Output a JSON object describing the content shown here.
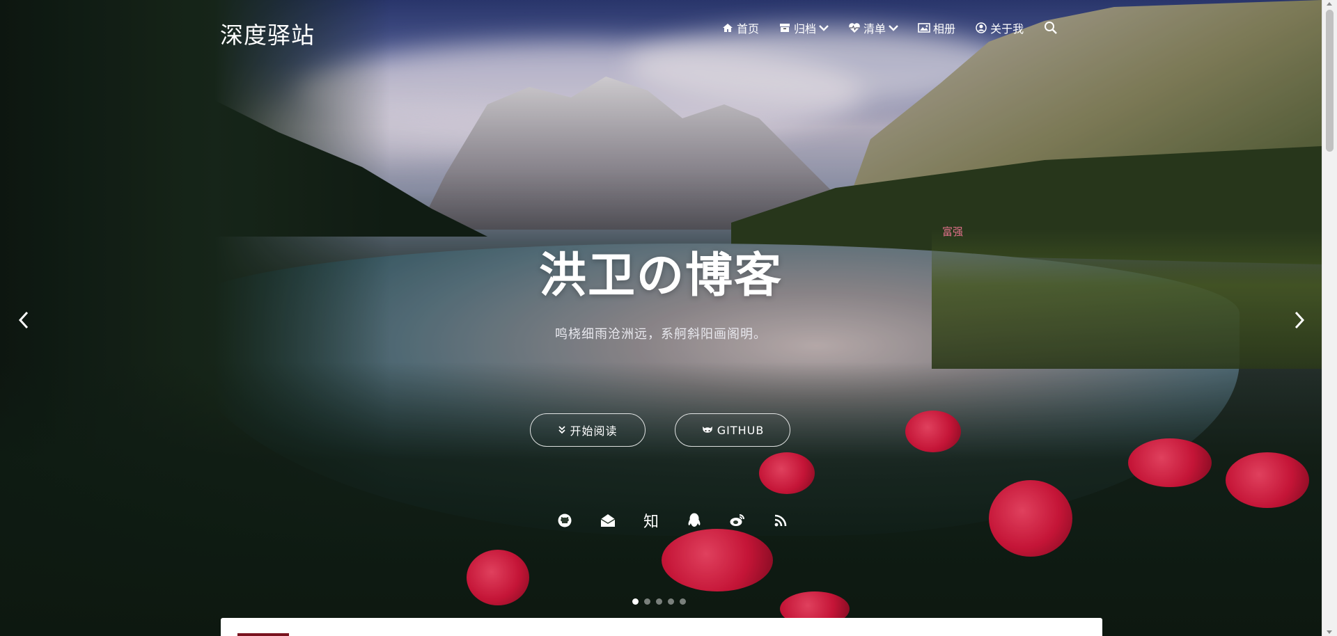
{
  "brand": "深度驿站",
  "nav": {
    "home": "首页",
    "archive": "归档",
    "list": "清单",
    "album": "相册",
    "about": "关于我"
  },
  "icons": {
    "home": "home-icon",
    "archive": "archive-icon",
    "list": "heartbeat-icon",
    "album": "image-icon",
    "about": "user-circle-icon",
    "search": "search-icon",
    "start": "double-chevron-down-icon",
    "github": "github-cat-icon",
    "prev": "chevron-left-icon",
    "next": "chevron-right-icon"
  },
  "hero": {
    "title": "洪卫の博客",
    "subtitle": "鸣桡细雨沧洲远，系舸斜阳画阁明。",
    "start_button": "开始阅读",
    "github_button": "GITHUB"
  },
  "socials": {
    "github": "github-icon",
    "mail": "mail-open-icon",
    "zhihu": "知",
    "qq": "qq-penguin-icon",
    "weibo": "weibo-icon",
    "rss": "rss-icon"
  },
  "carousel": {
    "slides": 5,
    "active_index": 0
  },
  "map_label": "富强",
  "colors": {
    "text": "#ffffff",
    "flower_red": "#e0183f",
    "card_accent": "#7a1420"
  }
}
